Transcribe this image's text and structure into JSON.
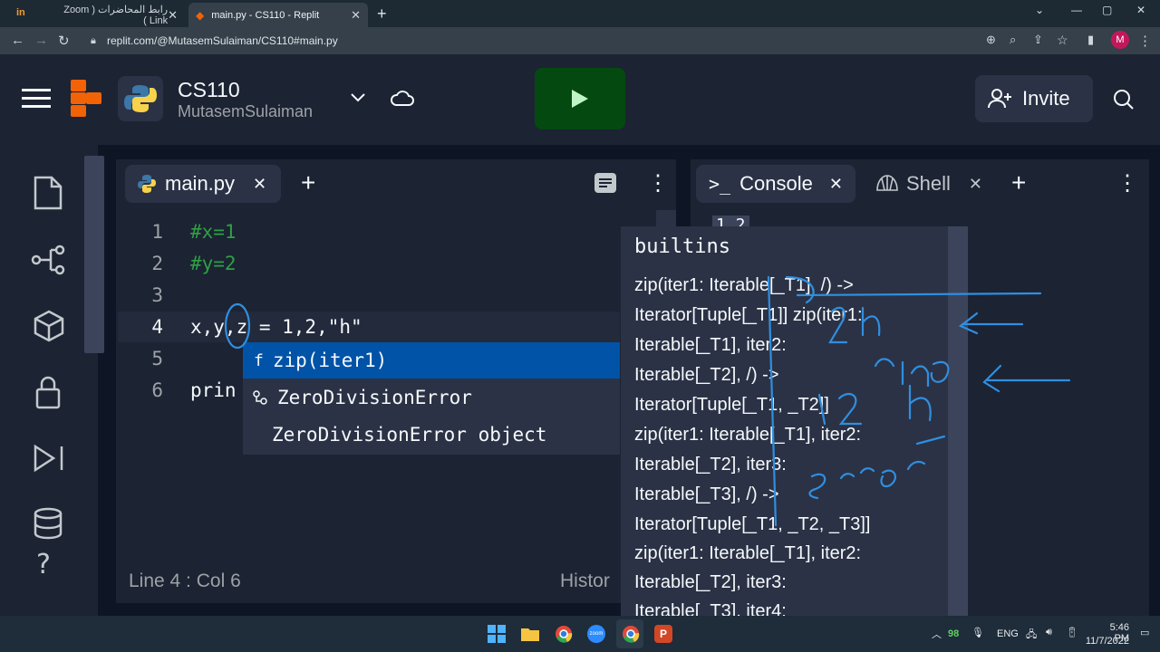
{
  "browser": {
    "tabs": [
      {
        "title": "رابط المحاضرات ( Zoom Link )"
      },
      {
        "title": "main.py - CS110 - Replit"
      }
    ],
    "url": "replit.com/@MutasemSulaiman/CS110#main.py",
    "profile_initial": "M"
  },
  "project": {
    "name": "CS110",
    "owner": "MutasemSulaiman",
    "invite_label": "Invite"
  },
  "editor": {
    "file_tab": "main.py",
    "lines": [
      {
        "n": "1",
        "text": "#x=1",
        "kind": "comment"
      },
      {
        "n": "2",
        "text": "#y=2",
        "kind": "comment"
      },
      {
        "n": "3",
        "text": "",
        "kind": "code"
      },
      {
        "n": "4",
        "text": "x,y,z = 1,2,\"h\"",
        "kind": "code"
      },
      {
        "n": "5",
        "text": "",
        "kind": "code"
      },
      {
        "n": "6",
        "text": "prin",
        "kind": "code"
      }
    ],
    "status": "Line 4 : Col 6",
    "history_label": "Histor"
  },
  "autocomplete": {
    "items": [
      {
        "icon": "f",
        "label": "zip(iter1)"
      },
      {
        "icon": "class-icon",
        "label": "ZeroDivisionError"
      },
      {
        "icon": "",
        "label": "ZeroDivisionError object"
      }
    ]
  },
  "docs": {
    "title": "builtins",
    "lines": [
      "zip(iter1: Iterable[_T1], /) ->",
      "Iterator[Tuple[_T1]] zip(iter1:",
      "Iterable[_T1], iter2:",
      "Iterable[_T2], /) ->",
      "Iterator[Tuple[_T1, _T2]]",
      "zip(iter1: Iterable[_T1], iter2:",
      "Iterable[_T2], iter3:",
      "Iterable[_T3], /) ->",
      "Iterator[Tuple[_T1, _T2, _T3]]",
      "zip(iter1: Iterable[_T1], iter2:",
      "Iterable[_T2], iter3:",
      "Iterable[_T3], iter4:"
    ]
  },
  "console": {
    "console_tab": "Console",
    "shell_tab": "Shell",
    "output_partial": "1 2"
  },
  "taskbar": {
    "language": "ENG",
    "time": "5:46 PM",
    "date": "11/7/2022",
    "battery": "98"
  },
  "annotation_color": "#2f8fe0"
}
